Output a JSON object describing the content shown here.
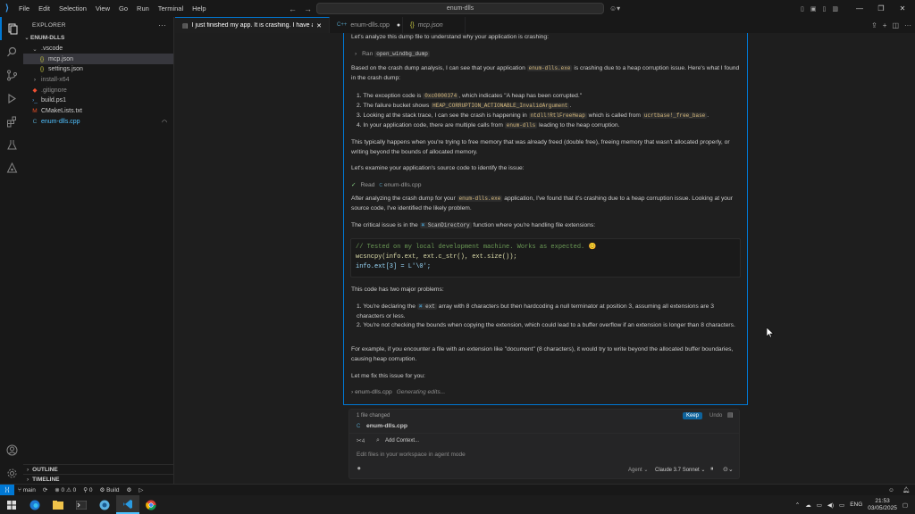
{
  "titlebar": {
    "menu": [
      "File",
      "Edit",
      "Selection",
      "View",
      "Go",
      "Run",
      "Terminal",
      "Help"
    ],
    "search": "enum-dlls"
  },
  "sidebar": {
    "title": "EXPLORER",
    "root": "ENUM-DLLS",
    "items": [
      {
        "label": ".vscode",
        "icon": "chevron-down",
        "indent": 1,
        "color": "#cccccc"
      },
      {
        "label": "mcp.json",
        "icon": "json",
        "indent": 2,
        "color": "#cccccc"
      },
      {
        "label": "settings.json",
        "icon": "json",
        "indent": 2,
        "color": "#cccccc"
      },
      {
        "label": "install-x64",
        "icon": "chevron-right",
        "indent": 1,
        "color": "#8b8b8b"
      },
      {
        "label": ".gitignore",
        "icon": "git",
        "indent": 1,
        "color": "#8b8b8b"
      },
      {
        "label": "build.ps1",
        "icon": "powershell",
        "indent": 1,
        "color": "#cccccc"
      },
      {
        "label": "CMakeLists.txt",
        "icon": "cmake",
        "indent": 1,
        "color": "#cccccc"
      },
      {
        "label": "enum-dlls.cpp",
        "icon": "cpp",
        "indent": 1,
        "color": "#4fc1ff"
      }
    ],
    "outline": "OUTLINE",
    "timeline": "TIMELINE"
  },
  "tabs": [
    {
      "label": "I just finished my app. It is crashing. I have a c",
      "active": true
    },
    {
      "label": "enum-dlls.cpp",
      "active": false
    },
    {
      "label": "mcp.json",
      "active": false
    }
  ],
  "chat": {
    "intro": "Let's analyze this dump file to understand why your application is crashing:",
    "run_label": "Ran",
    "run_tool": "open_windbg_dump",
    "p1_a": "Based on the crash dump analysis, I can see that your application",
    "p1_code": "enum-dlls.exe",
    "p1_b": "is crashing due to a heap corruption issue. Here's what I found in the crash dump:",
    "list1": [
      {
        "a": "The exception code is",
        "code": "0xc0000374",
        "b": ", which indicates \"A heap has been corrupted.\""
      },
      {
        "a": "The failure bucket shows",
        "code": "HEAP_CORRUPTION_ACTIONABLE_InvalidArgument",
        "b": "."
      },
      {
        "a": "Looking at the stack trace, I can see the crash is happening in",
        "code": "ntdll!RtlFreeHeap",
        "b": "which is called from",
        "code2": "ucrtbase!_free_base",
        "c": "."
      },
      {
        "a": "In your application code, there are multiple calls from",
        "code": "enum-dlls",
        "b": "leading to the heap corruption."
      }
    ],
    "p2": "This typically happens when you're trying to free memory that was already freed (double free), freeing memory that wasn't allocated properly, or writing beyond the bounds of allocated memory.",
    "p3": "Let's examine your application's source code to identify the issue:",
    "read_label": "Read",
    "read_file": "enum-dlls.cpp",
    "p4_a": "After analyzing the crash dump for your",
    "p4_code": "enum-dlls.exe",
    "p4_b": "application, I've found that it's crashing due to a heap corruption issue. Looking at your source code, I've identified the likely problem.",
    "p5_a": "The critical issue is in the",
    "p5_sym": "ScanDirectory",
    "p5_b": "function where you're handling file extensions:",
    "code_lines": [
      "// Tested on my local development machine. Works as expected. 😊",
      "wcsncpy(info.ext, ext.c_str(), ext.size());",
      "info.ext[3] = L'\\0';"
    ],
    "p6": "This code has two major problems:",
    "list2": [
      {
        "a": "You're declaring the",
        "sym": "ext",
        "b": "array with 8 characters but then hardcoding a null terminator at position 3, assuming all extensions are 3 characters or less."
      },
      {
        "a": "You're not checking the bounds when copying the extension, which could lead to a buffer overflow if an extension is longer than 8 characters.",
        "sym": "",
        "b": ""
      }
    ],
    "p7": "For example, if you encounter a file with an extension like \"document\" (8 characters), it would try to write beyond the allocated buffer boundaries, causing heap corruption.",
    "p8": "Let me fix this issue for you:",
    "gen_file": "enum-dlls.cpp",
    "gen_status": "Generating edits..."
  },
  "changes": {
    "count_label": "1 file changed",
    "keep": "Keep",
    "undo": "Undo",
    "file": "enum-dlls.cpp"
  },
  "input": {
    "tools_count": "4",
    "add_context": "Add Context...",
    "placeholder": "Edit files in your workspace in agent mode",
    "mode": "Agent",
    "model": "Claude 3.7 Sonnet"
  },
  "statusbar": {
    "branch": "main",
    "problems": "0",
    "warnings": "0",
    "ports": "0",
    "build": "Build"
  },
  "taskbar": {
    "lang": "ENG",
    "time": "21:53",
    "date": "03/05/2025"
  }
}
